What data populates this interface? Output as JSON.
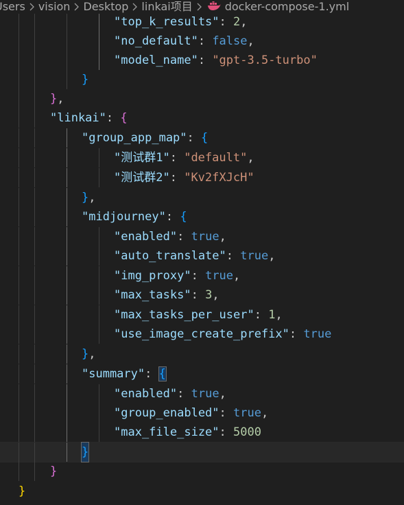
{
  "breadcrumb": {
    "items": [
      "Users",
      "vision",
      "Desktop",
      "linkai项目"
    ],
    "file": "docker-compose-1.yml",
    "file_icon": "docker-whale-icon"
  },
  "colors": {
    "background": "#1f1f1f",
    "key": "#9cdcfe",
    "string": "#ce9178",
    "keyword": "#569cd6",
    "number": "#b5cea8",
    "bracket_gold": "#ffd700",
    "bracket_orchid": "#da70d6",
    "bracket_blue": "#179fff"
  },
  "code": {
    "line1_key": "\"top_k_results\"",
    "line1_val": "2",
    "line2_key": "\"no_default\"",
    "line2_val": "false",
    "line3_key": "\"model_name\"",
    "line3_val": "\"gpt-3.5-turbo\"",
    "linkai_key": "\"linkai\"",
    "group_app_map_key": "\"group_app_map\"",
    "group1_key": "\"测试群1\"",
    "group1_val": "\"default\"",
    "group2_key": "\"测试群2\"",
    "group2_val": "\"Kv2fXJcH\"",
    "midjourney_key": "\"midjourney\"",
    "mj_enabled_key": "\"enabled\"",
    "mj_enabled_val": "true",
    "mj_auto_translate_key": "\"auto_translate\"",
    "mj_auto_translate_val": "true",
    "mj_img_proxy_key": "\"img_proxy\"",
    "mj_img_proxy_val": "true",
    "mj_max_tasks_key": "\"max_tasks\"",
    "mj_max_tasks_val": "3",
    "mj_max_tasks_per_user_key": "\"max_tasks_per_user\"",
    "mj_max_tasks_per_user_val": "1",
    "mj_use_image_create_prefix_key": "\"use_image_create_prefix\"",
    "mj_use_image_create_prefix_val": "true",
    "summary_key": "\"summary\"",
    "sum_enabled_key": "\"enabled\"",
    "sum_enabled_val": "true",
    "sum_group_enabled_key": "\"group_enabled\"",
    "sum_group_enabled_val": "true",
    "sum_max_file_size_key": "\"max_file_size\"",
    "sum_max_file_size_val": "5000"
  }
}
